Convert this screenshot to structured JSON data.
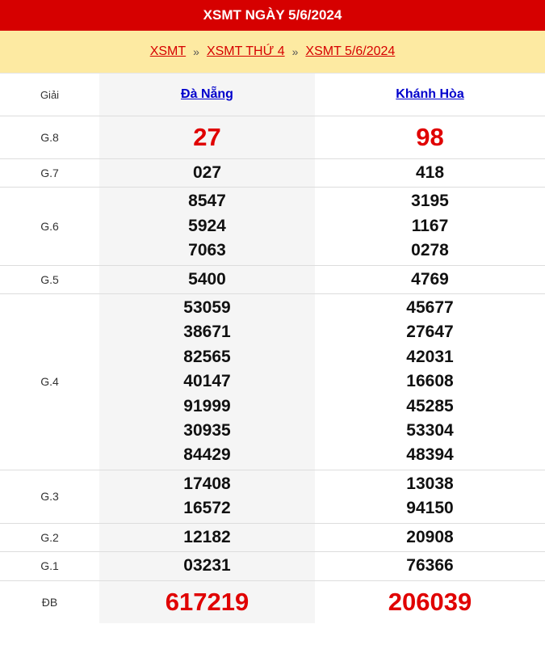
{
  "header": {
    "title": "XSMT NGÀY 5/6/2024"
  },
  "breadcrumb": {
    "items": [
      "XSMT",
      "XSMT THỨ 4",
      "XSMT 5/6/2024"
    ],
    "separator": "»"
  },
  "table": {
    "label_header": "Giải",
    "provinces": [
      "Đà Nẵng",
      "Khánh Hòa"
    ],
    "prizes": [
      {
        "name": "G.8",
        "da_nang": [
          "27"
        ],
        "khanh_hoa": [
          "98"
        ]
      },
      {
        "name": "G.7",
        "da_nang": [
          "027"
        ],
        "khanh_hoa": [
          "418"
        ]
      },
      {
        "name": "G.6",
        "da_nang": [
          "8547",
          "5924",
          "7063"
        ],
        "khanh_hoa": [
          "3195",
          "1167",
          "0278"
        ]
      },
      {
        "name": "G.5",
        "da_nang": [
          "5400"
        ],
        "khanh_hoa": [
          "4769"
        ]
      },
      {
        "name": "G.4",
        "da_nang": [
          "53059",
          "38671",
          "82565",
          "40147",
          "91999",
          "30935",
          "84429"
        ],
        "khanh_hoa": [
          "45677",
          "27647",
          "42031",
          "16608",
          "45285",
          "53304",
          "48394"
        ]
      },
      {
        "name": "G.3",
        "da_nang": [
          "17408",
          "16572"
        ],
        "khanh_hoa": [
          "13038",
          "94150"
        ]
      },
      {
        "name": "G.2",
        "da_nang": [
          "12182"
        ],
        "khanh_hoa": [
          "20908"
        ]
      },
      {
        "name": "G.1",
        "da_nang": [
          "03231"
        ],
        "khanh_hoa": [
          "76366"
        ]
      },
      {
        "name": "ĐB",
        "da_nang": [
          "617219"
        ],
        "khanh_hoa": [
          "206039"
        ]
      }
    ]
  },
  "colors": {
    "accent": "#d60000",
    "breadcrumb_bg": "#fdeaa2",
    "highlight_number": "#e00000",
    "link": "#0000cc"
  }
}
